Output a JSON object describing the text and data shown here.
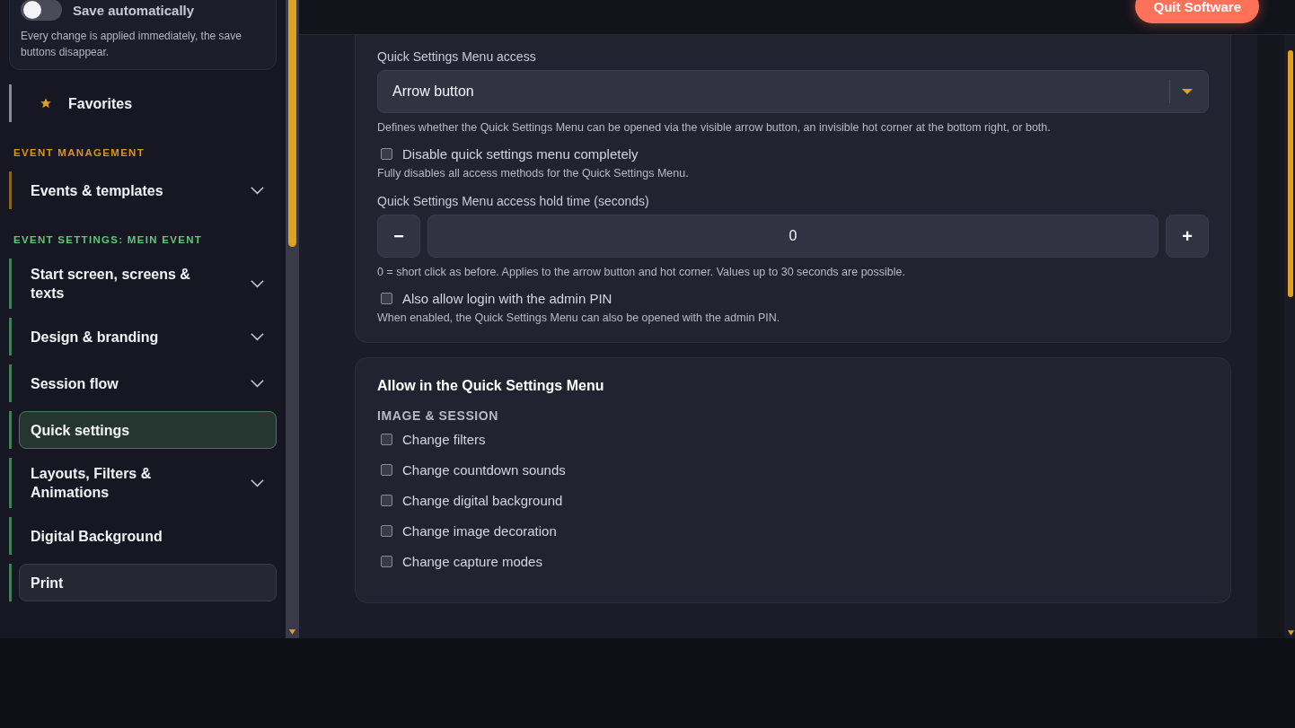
{
  "sidebar": {
    "autosave": {
      "label": "Save automatically",
      "on": false,
      "description": "Every change is applied immediately, the save buttons disappear."
    },
    "sections": [
      {
        "color": "#8a8b96",
        "items": [
          {
            "label": "Favorites",
            "kind": "favorite",
            "expandable": false,
            "selected": false,
            "hovered": false
          }
        ]
      },
      {
        "heading": "EVENT MANAGEMENT",
        "color": "#d4961c",
        "items": [
          {
            "label": "Events & templates",
            "kind": "item",
            "expandable": true,
            "selected": false,
            "hovered": false
          }
        ]
      },
      {
        "heading": "EVENT SETTINGS: MEIN EVENT",
        "color": "#5fc77a",
        "items": [
          {
            "label": "Start screen, screens & texts",
            "kind": "item",
            "expandable": true,
            "selected": false,
            "hovered": false
          },
          {
            "label": "Design & branding",
            "kind": "item",
            "expandable": true,
            "selected": false,
            "hovered": false
          },
          {
            "label": "Session flow",
            "kind": "item",
            "expandable": true,
            "selected": false,
            "hovered": false
          },
          {
            "label": "Quick settings",
            "kind": "item",
            "expandable": false,
            "selected": true,
            "hovered": false
          },
          {
            "label": "Layouts, Filters & Animations",
            "kind": "item",
            "expandable": true,
            "selected": false,
            "hovered": false
          },
          {
            "label": "Digital Background",
            "kind": "item",
            "expandable": false,
            "selected": false,
            "hovered": false
          },
          {
            "label": "Print",
            "kind": "item",
            "expandable": false,
            "selected": false,
            "hovered": true
          }
        ]
      }
    ]
  },
  "header": {
    "quit_button": "Quit Software"
  },
  "access_card": {
    "access_label": "Quick Settings Menu access",
    "access_value": "Arrow button",
    "access_help": "Defines whether the Quick Settings Menu can be opened via the visible arrow button, an invisible hot corner at the bottom right, or both.",
    "disable": {
      "label": "Disable quick settings menu completely",
      "checked": false,
      "help": "Fully disables all access methods for the Quick Settings Menu."
    },
    "hold_label": "Quick Settings Menu access hold time (seconds)",
    "minus": "−",
    "hold_value": "0",
    "plus": "+",
    "hold_help": "0 = short click as before. Applies to the arrow button and hot corner. Values up to 30 seconds are possible.",
    "admin_pin": {
      "label": "Also allow login with the admin PIN",
      "checked": false,
      "help": "When enabled, the Quick Settings Menu can also be opened with the admin PIN."
    }
  },
  "allow_card": {
    "title": "Allow in the Quick Settings Menu",
    "group": "IMAGE & SESSION",
    "options": [
      {
        "label": "Change filters",
        "checked": false
      },
      {
        "label": "Change countdown sounds",
        "checked": false
      },
      {
        "label": "Change digital background",
        "checked": false
      },
      {
        "label": "Change image decoration",
        "checked": false
      },
      {
        "label": "Change capture modes",
        "checked": false
      }
    ]
  }
}
